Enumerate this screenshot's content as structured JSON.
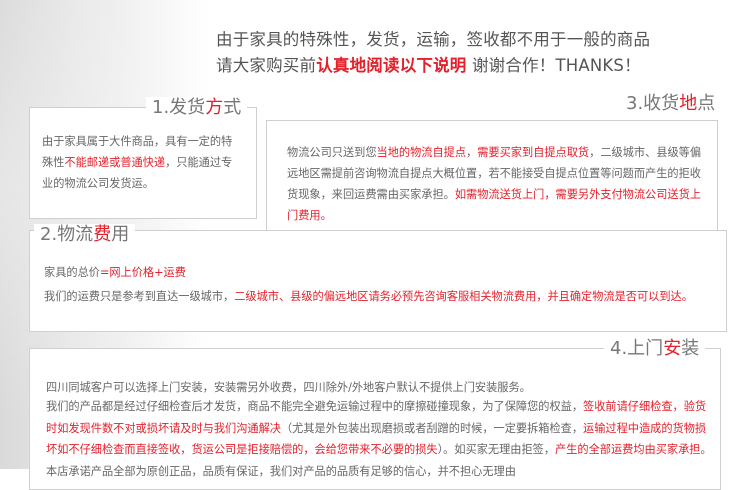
{
  "intro": {
    "line1": "由于家具的特殊性，发货，运输，签收都不用于一般的商品",
    "line2_pre": "请大家购买前",
    "line2_red": "认真地阅读以下说明",
    "line2_post": " 谢谢合作！THANKS！"
  },
  "section1": {
    "title_pre": "1.发货",
    "title_red": "方",
    "title_post": "式",
    "text_pre": "由于家具属于大件商品，具有一定的特殊性",
    "text_red": "不能邮递或普通快递",
    "text_post": "，只能通过专业的物流公司发货运。"
  },
  "section3": {
    "title_pre": "3.收货",
    "title_red": "地",
    "title_post": "点",
    "text_1": "物流公司只送到您",
    "text_red1": "当地的物流自提点",
    "text_2": "，",
    "text_red2": "需要买家到自提点取货",
    "text_3": "，二级城市、县级等偏远地区需提前咨询物流自提点大概位置，若不能接受自提点位置等问题而产生的拒收货现象，来回运费需由买家承担。",
    "text_red3": "如需物流送货上门，需要另外支付物流公司送货上门费用。"
  },
  "section2": {
    "title_pre": "2.物流",
    "title_red": "费",
    "title_post": "用",
    "total_pre": "家具的总价",
    "total_red": "=网上价格+运费",
    "note_pre": "我们的运费只是参考到直达一级城市，",
    "note_red": "二级城市、县级的偏远地区请务必预先咨询客服相关物流费用，并且确定物流是否可以到达。"
  },
  "section4": {
    "title_pre": "4.上门",
    "title_red": "安",
    "title_post": "装",
    "line1": "四川同城客户可以选择上门安装，安装需另外收费，四川除外/外地客户默认不提供上门安装服务。",
    "p_1": "我们的产品都是经过仔细检查后才发货，商品不能完全避免运输过程中的摩擦碰撞现象，为了保障您的权益，",
    "p_red1": "签收前请仔细检查，验货时如发现件数不对或损坏请及时与我们沟通解决",
    "p_2": "（尤其是外包装出现磨损或者刮蹭的时候，一定要拆箱检查，",
    "p_red2": "运输过程中造成的货物损坏如不仔细检查而直接签收，货运公司是拒接赔偿的，会给您带来不必要的损失",
    "p_3": "）。如买家无理由拒签，",
    "p_red3": "产生的全部运费均由买家承担",
    "p_4": "。本店承诺产品全部为原创正品，品质有保证，我们对产品的品质有足够的信心，并不担心无理由"
  }
}
